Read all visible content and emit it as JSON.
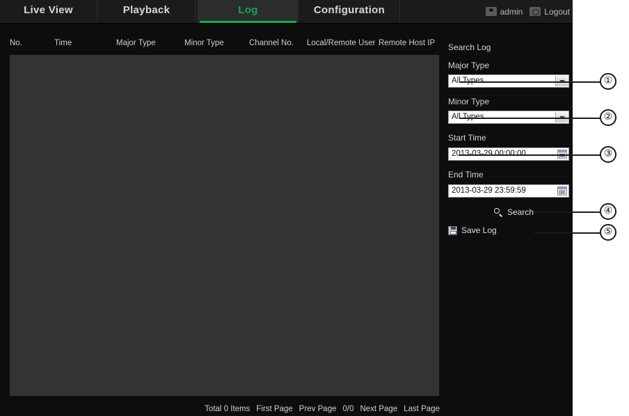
{
  "app": {
    "tabs": [
      {
        "label": "Live View",
        "active": false
      },
      {
        "label": "Playback",
        "active": false
      },
      {
        "label": "Log",
        "active": true
      },
      {
        "label": "Configuration",
        "active": false
      }
    ],
    "account": {
      "user_icon": "user-icon",
      "user_label": "admin",
      "logout_icon": "logout-icon",
      "logout_label": "Logout"
    }
  },
  "log_table": {
    "columns": [
      "No.",
      "Time",
      "Major Type",
      "Minor Type",
      "Channel No.",
      "Local/Remote User",
      "Remote Host IP"
    ],
    "rows": []
  },
  "pagination": {
    "total": "Total 0 Items",
    "first_page": "First Page",
    "prev_page": "Prev Page",
    "page_indicator": "0/0",
    "next_page": "Next Page",
    "last_page": "Last Page"
  },
  "search_panel": {
    "title": "Search Log",
    "major_type": {
      "label": "Major Type",
      "value": "All Types",
      "icon": "chevron-down-icon"
    },
    "minor_type": {
      "label": "Minor Type",
      "value": "All Types",
      "icon": "chevron-down-icon"
    },
    "start_time": {
      "label": "Start Time",
      "value": "2013-03-29 00:00:00",
      "icon": "calendar-icon"
    },
    "end_time": {
      "label": "End Time",
      "value": "2013-03-29 23:59:59",
      "icon": "calendar-icon"
    },
    "search_button": {
      "label": "Search",
      "icon": "search-icon"
    },
    "save_log_button": {
      "label": "Save Log",
      "icon": "floppy-disk-icon"
    }
  },
  "callouts": [
    {
      "number": "①",
      "target": "major-type-select"
    },
    {
      "number": "②",
      "target": "minor-type-select"
    },
    {
      "number": "③",
      "target": "start-time-field"
    },
    {
      "number": "④",
      "target": "search-button"
    },
    {
      "number": "⑤",
      "target": "save-log-button"
    }
  ],
  "colors": {
    "accent_green": "#18a558",
    "panel_bg": "#0d0d0d",
    "table_bg": "#333333",
    "tab_active_bg": "#2c2c2c"
  }
}
